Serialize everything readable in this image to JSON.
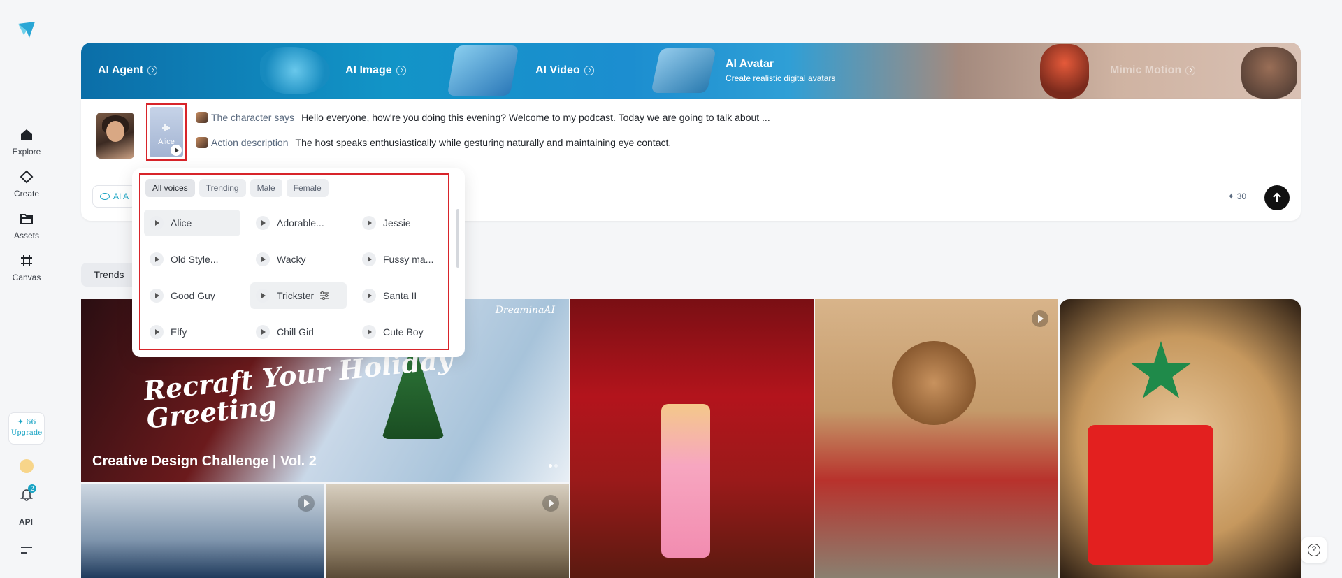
{
  "sidebar": {
    "items": [
      {
        "label": "Explore",
        "icon": "home-icon"
      },
      {
        "label": "Create",
        "icon": "diamond-icon"
      },
      {
        "label": "Assets",
        "icon": "folder-icon"
      },
      {
        "label": "Canvas",
        "icon": "grid-icon"
      }
    ],
    "credits": "66",
    "upgrade": "Upgrade",
    "notifications": "2",
    "api": "API"
  },
  "tools": [
    {
      "label": "AI Agent"
    },
    {
      "label": "AI Image"
    },
    {
      "label": "AI Video"
    },
    {
      "label": "AI Avatar",
      "subtitle": "Create realistic digital avatars"
    },
    {
      "label": "Mimic Motion"
    }
  ],
  "prompt": {
    "voice_name": "Alice",
    "character_tag": "The character says",
    "character_text": "Hello everyone, how're you doing this evening? Welcome to my podcast. Today we are going to talk about ...",
    "action_tag": "Action description",
    "action_text": "The host speaks enthusiastically while gesturing naturally and maintaining eye contact.",
    "agent_label": "AI A",
    "cost": "30"
  },
  "voices": {
    "filters": [
      "All voices",
      "Trending",
      "Male",
      "Female"
    ],
    "items": [
      "Alice",
      "Adorable...",
      "Jessie",
      "Old Style...",
      "Wacky",
      "Fussy ma...",
      "Good Guy",
      "Trickster",
      "Santa II",
      "Elfy",
      "Chill Girl",
      "Cute Boy"
    ]
  },
  "trends_tab": "Trends",
  "gallery": {
    "feature_title": "Creative Design Challenge | Vol. 2",
    "feature_script": "Recraft Your Holiday Greeting",
    "brand": "DreaminaAI"
  },
  "colors": {
    "accent": "#1aa4c4",
    "highlight": "#d8242a"
  }
}
